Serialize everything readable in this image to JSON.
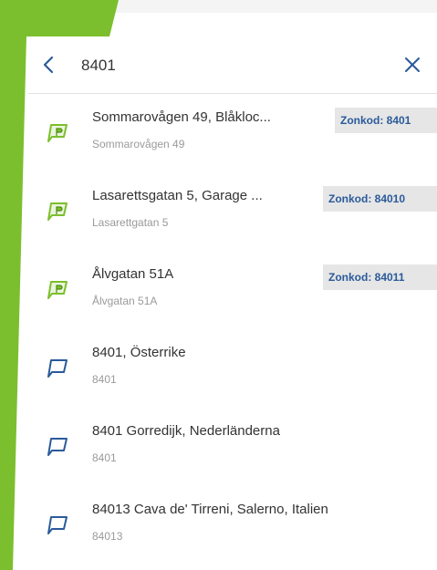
{
  "search": {
    "value": "8401",
    "back_icon": "chevron-left-icon",
    "clear_icon": "close-icon"
  },
  "colors": {
    "brand_green": "#7cbf2e",
    "zone_badge_text": "#2a5a9a",
    "zone_badge_bg": "#e6e6e6",
    "title_text": "#333333",
    "subtitle_text": "#9a9a9a",
    "place_icon": "#2a5a9a"
  },
  "results": [
    {
      "title": "Sommarovågen 49, Blåkloc...",
      "subtitle": "Sommarovågen 49",
      "zone": "Zonkod: 8401",
      "icon": "parking-pin-icon"
    },
    {
      "title": "Lasarettsgatan 5, Garage ...",
      "subtitle": "Lasarettgatan 5",
      "zone": "Zonkod: 84010",
      "icon": "parking-pin-icon"
    },
    {
      "title": "Ålvgatan 51A",
      "subtitle": "Ålvgatan 51A",
      "zone": "Zonkod: 84011",
      "icon": "parking-pin-icon"
    },
    {
      "title": "8401, Österrike",
      "subtitle": "8401",
      "zone": "",
      "icon": "place-pin-icon"
    },
    {
      "title": "8401 Gorredijk, Nederländerna",
      "subtitle": "8401",
      "zone": "",
      "icon": "place-pin-icon"
    },
    {
      "title": "84013 Cava de' Tirreni, Salerno, Italien",
      "subtitle": "84013",
      "zone": "",
      "icon": "place-pin-icon"
    }
  ]
}
